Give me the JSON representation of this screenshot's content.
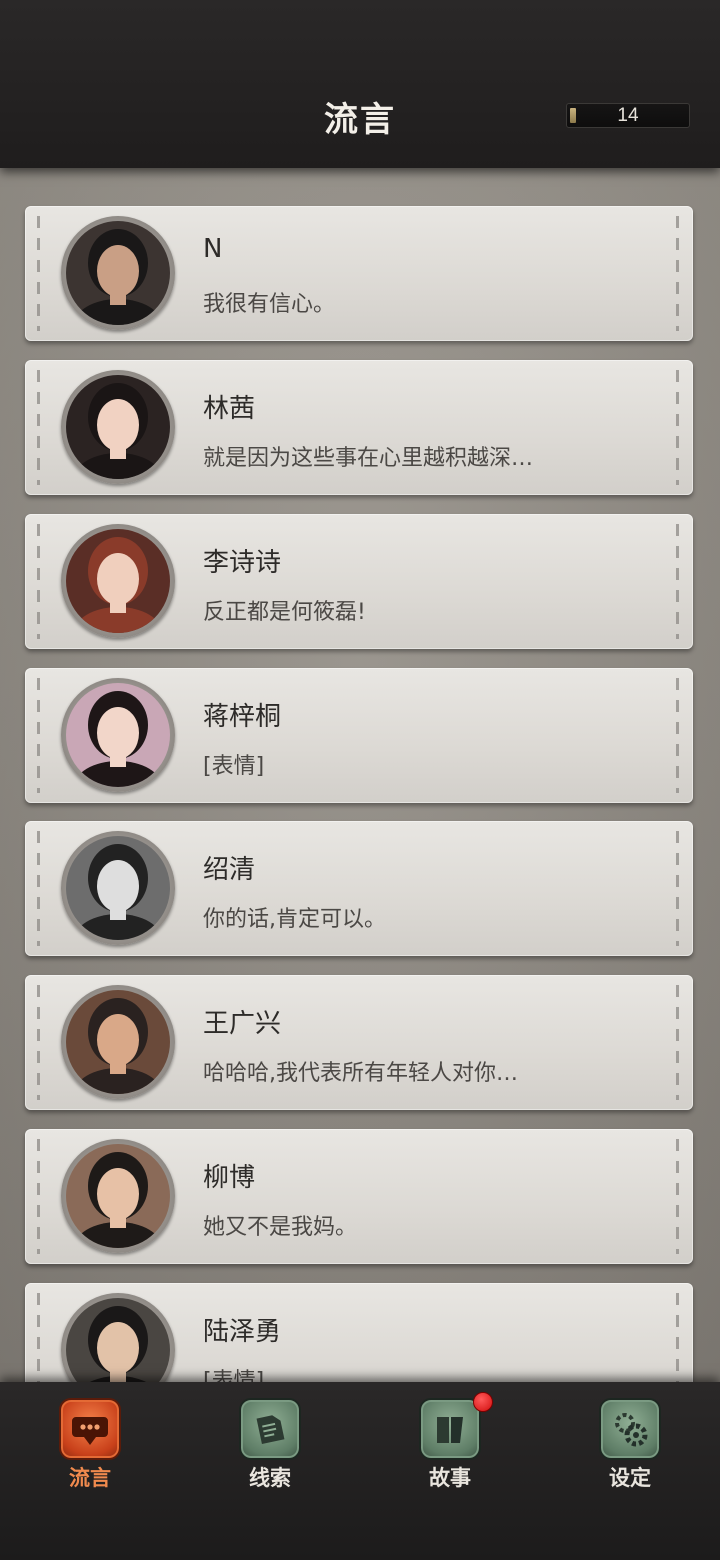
{
  "header": {
    "title": "流言",
    "counter_value": "14"
  },
  "contacts": [
    {
      "name": "N",
      "message": "我很有信心。",
      "avatar": "n-avatar",
      "colors": [
        "#3c3431",
        "#c99f85",
        "#1a1818"
      ]
    },
    {
      "name": "林茜",
      "message": "就是因为这些事在心里越积越深…",
      "avatar": "linxi-avatar",
      "colors": [
        "#2b2322",
        "#f1d2c2",
        "#1a1515"
      ]
    },
    {
      "name": "李诗诗",
      "message": "反正都是何筱磊!",
      "avatar": "lishishi-avatar",
      "colors": [
        "#5a2e26",
        "#f0cfbd",
        "#8a3b2a"
      ]
    },
    {
      "name": "蒋梓桐",
      "message": "[表情]",
      "avatar": "jiangzitong-avatar",
      "colors": [
        "#c9a7b6",
        "#f2d6c9",
        "#1e1617"
      ]
    },
    {
      "name": "绍清",
      "message": "你的话,肯定可以。",
      "avatar": "shaoqing-avatar",
      "colors": [
        "#6d6d6d",
        "#dedede",
        "#222222"
      ]
    },
    {
      "name": "王广兴",
      "message": "哈哈哈,我代表所有年轻人对你…",
      "avatar": "wangguangxing-avatar",
      "colors": [
        "#6a4a3a",
        "#d9a888",
        "#2a2220"
      ]
    },
    {
      "name": "柳博",
      "message": "她又不是我妈。",
      "avatar": "liubo-avatar",
      "colors": [
        "#8a6a58",
        "#e7c1a6",
        "#1e1a18"
      ]
    },
    {
      "name": "陆泽勇",
      "message": "[表情]",
      "avatar": "luzeyong-avatar",
      "colors": [
        "#4a4642",
        "#e2c2a8",
        "#1a1818"
      ]
    }
  ],
  "nav": {
    "items": [
      {
        "label": "流言",
        "icon": "chat-bubble-icon",
        "active": true
      },
      {
        "label": "线索",
        "icon": "document-icon",
        "active": false
      },
      {
        "label": "故事",
        "icon": "book-icon",
        "active": false,
        "badge": true
      },
      {
        "label": "设定",
        "icon": "gear-icon",
        "active": false
      }
    ]
  },
  "theme": {
    "accent": "#f08a4e",
    "header_bg": "#242222",
    "card_bg": "#e2e0dc",
    "badge": "#e01010"
  }
}
